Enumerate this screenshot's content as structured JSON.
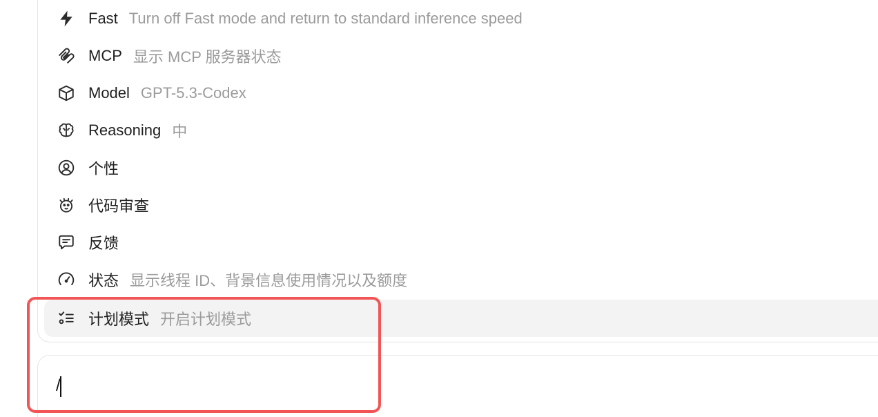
{
  "menu": {
    "items": [
      {
        "key": "fast",
        "icon": "lightning-icon",
        "label": "Fast",
        "desc": "Turn off Fast mode and return to standard inference speed"
      },
      {
        "key": "mcp",
        "icon": "mcp-icon",
        "label": "MCP",
        "desc": "显示 MCP 服务器状态"
      },
      {
        "key": "model",
        "icon": "cube-icon",
        "label": "Model",
        "desc": "GPT-5.3-Codex"
      },
      {
        "key": "reasoning",
        "icon": "brain-icon",
        "label": "Reasoning",
        "desc": "中"
      },
      {
        "key": "personality",
        "icon": "user-circle-icon",
        "label": "个性",
        "desc": ""
      },
      {
        "key": "code-review",
        "icon": "bug-icon",
        "label": "代码审查",
        "desc": ""
      },
      {
        "key": "feedback",
        "icon": "message-icon",
        "label": "反馈",
        "desc": ""
      },
      {
        "key": "status",
        "icon": "gauge-icon",
        "label": "状态",
        "desc": "显示线程 ID、背景信息使用情况以及额度"
      },
      {
        "key": "plan-mode",
        "icon": "checklist-icon",
        "label": "计划模式",
        "desc": "开启计划模式",
        "selected": true
      }
    ]
  },
  "composer": {
    "value": "/"
  },
  "colors": {
    "highlight": "#f25555",
    "selected_bg": "#f3f3f3",
    "label": "#1f1f1f",
    "desc": "#9b9b9b"
  }
}
